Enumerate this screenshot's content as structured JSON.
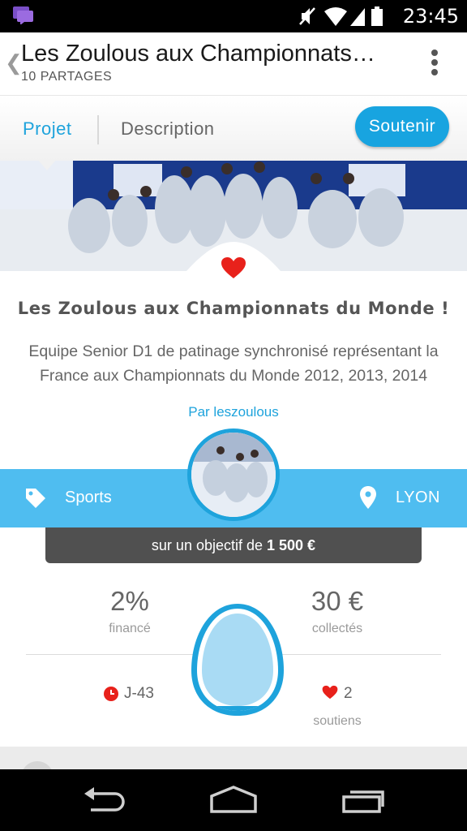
{
  "status_bar": {
    "time": "23:45"
  },
  "header": {
    "title": "Les Zoulous aux Championnats…",
    "shares": "10 PARTAGES"
  },
  "tabs": {
    "projet": "Projet",
    "description": "Description",
    "support_button": "Soutenir"
  },
  "project": {
    "title": "Les Zoulous aux Championnats du Monde !",
    "description": "Equipe Senior D1 de patinage synchronisé représentant la France aux Championnats du Monde 2012, 2013, 2014",
    "author": "Par leszoulous",
    "category": "Sports",
    "location": "LYON"
  },
  "goal": {
    "prefix": "sur un objectif de ",
    "amount": "1 500 €"
  },
  "stats": {
    "funded_percent": "2%",
    "funded_label": "financé",
    "collected": "30 €",
    "collected_label": "collectés",
    "days_left": "J-43",
    "supporters": "2",
    "supporters_label": "soutiens",
    "fill_fraction": 0.02
  },
  "colors": {
    "accent": "#1ea3dc",
    "band": "#4fbdf0",
    "heart": "#e8211b",
    "goal_bg": "#505050"
  },
  "icons": [
    "notification-icon",
    "mute-icon",
    "wifi-icon",
    "signal-icon",
    "battery-icon",
    "back-chevron-icon",
    "overflow-menu-icon",
    "heart-icon",
    "tag-icon",
    "location-pin-icon",
    "clock-icon",
    "egg-gauge-icon",
    "nav-back-icon",
    "nav-home-icon",
    "nav-recents-icon"
  ]
}
